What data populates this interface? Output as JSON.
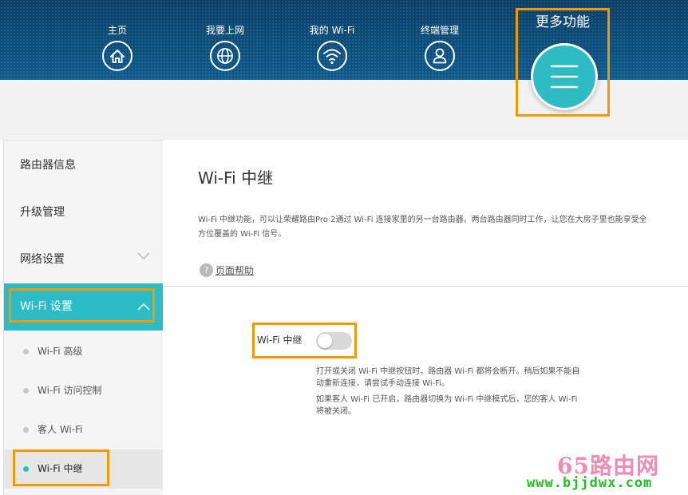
{
  "nav": {
    "items": [
      {
        "label": "主页",
        "icon": "home-icon"
      },
      {
        "label": "我要上网",
        "icon": "globe-icon"
      },
      {
        "label": "我的 Wi-Fi",
        "icon": "wifi-icon"
      },
      {
        "label": "终端管理",
        "icon": "user-icon"
      }
    ],
    "more": {
      "label": "更多功能",
      "icon": "menu-icon"
    }
  },
  "sidebar": {
    "items": [
      {
        "label": "路由器信息"
      },
      {
        "label": "升级管理"
      },
      {
        "label": "网络设置",
        "icon": "chevron-down-icon"
      },
      {
        "label": "Wi-Fi 设置",
        "icon": "chevron-up-icon",
        "active": true
      }
    ],
    "subitems": [
      {
        "label": "Wi-Fi 高级"
      },
      {
        "label": "Wi-Fi 访问控制"
      },
      {
        "label": "客人 Wi-Fi"
      },
      {
        "label": "Wi-Fi 中继",
        "active": true
      }
    ]
  },
  "main": {
    "title": "Wi-Fi 中继",
    "description": "Wi-Fi 中继功能，可以让荣耀路由Pro 2通过 Wi-Fi 连接家里的另一台路由器。两台路由器同时工作，让您在大房子里也能享受全方位覆盖的 Wi-Fi 信号。",
    "help_label": "页面帮助",
    "relay": {
      "label": "Wi-Fi 中继",
      "enabled": false
    },
    "notes": [
      "打开或关闭 Wi-Fi 中继按钮时，路由器 Wi-Fi 都将会断开。稍后如果不能自动重新连接，请尝试手动连接 Wi-Fi。",
      "如果客人 Wi-Fi 已开启，路由器切换为 Wi-Fi 中继模式后，您的客人 Wi-Fi 将被关闭。"
    ]
  },
  "watermark": {
    "top": "65路由网",
    "bottom": "www.bjjdwx.com"
  },
  "colors": {
    "accent": "#2bbcc5",
    "highlight": "#f39800",
    "nav_bg": "#0e5b8d"
  }
}
